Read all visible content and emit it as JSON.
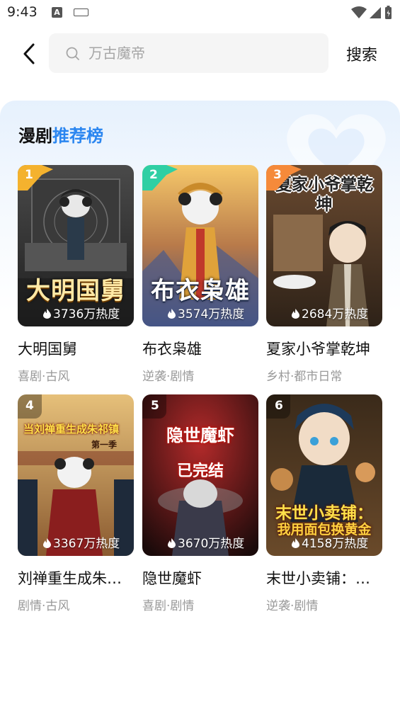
{
  "status_bar": {
    "time": "9:43",
    "notification_letter": "A"
  },
  "search": {
    "placeholder": "万古魔帝",
    "value": "",
    "button_label": "搜索"
  },
  "section": {
    "title_plain": "漫剧",
    "title_accent": "推荐榜"
  },
  "dramas": [
    {
      "rank": "1",
      "name": "大明国舅",
      "tags": "喜剧·古风",
      "heat": "3736万热度",
      "cover_text": "大明国舅",
      "badge_color": "#f4b22e"
    },
    {
      "rank": "2",
      "name": "布衣枭雄",
      "tags": "逆袭·剧情",
      "heat": "3574万热度",
      "cover_text": "布衣枭雄",
      "badge_color": "#2fcfa4"
    },
    {
      "rank": "3",
      "name": "夏家小爷掌乾坤",
      "tags": "乡村·都市日常",
      "heat": "2684万热度",
      "cover_text": "夏家小爷掌乾坤",
      "badge_color": "#f58a3a"
    },
    {
      "rank": "4",
      "name": "刘禅重生成朱…",
      "tags": "剧情·古风",
      "heat": "3367万热度",
      "cover_text": "当刘禅重生成朱祁镇",
      "cover_subtext": "第一季"
    },
    {
      "rank": "5",
      "name": "隐世魔虾",
      "tags": "喜剧·剧情",
      "heat": "3670万热度",
      "cover_text": "隐世魔虾",
      "cover_subtext": "已完结"
    },
    {
      "rank": "6",
      "name": "末世小卖铺：…",
      "tags": "逆袭·剧情",
      "heat": "4158万热度",
      "cover_text": "末世小卖铺：",
      "cover_subtext": "我用面包换黄金"
    }
  ]
}
